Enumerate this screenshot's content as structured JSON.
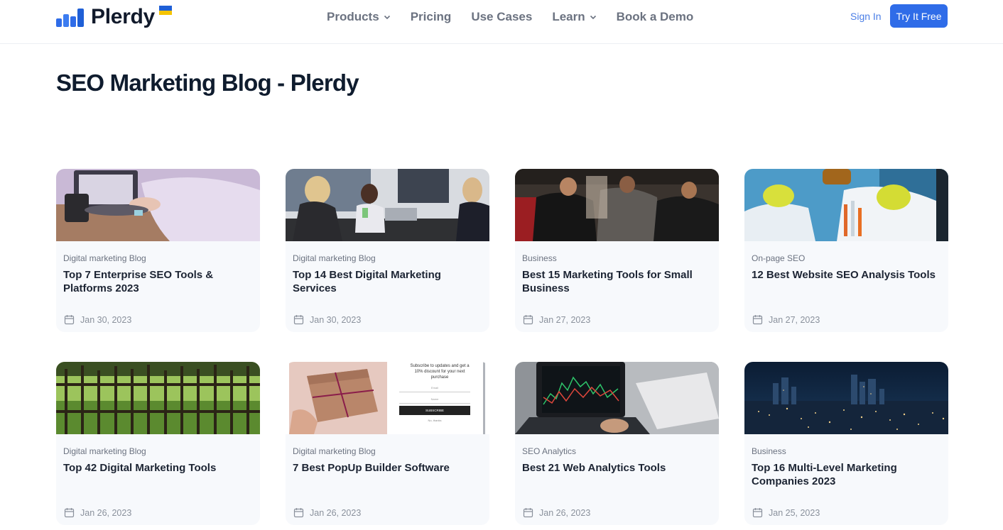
{
  "header": {
    "logo_text": "Plerdy",
    "nav": [
      {
        "label": "Products",
        "has_dropdown": true
      },
      {
        "label": "Pricing",
        "has_dropdown": false
      },
      {
        "label": "Use Cases",
        "has_dropdown": false
      },
      {
        "label": "Learn",
        "has_dropdown": true
      },
      {
        "label": "Book a Demo",
        "has_dropdown": false
      }
    ],
    "sign_in": "Sign In",
    "cta": "Try It Free"
  },
  "page_title": "SEO Marketing Blog - Plerdy",
  "colors": {
    "accent": "#2f6ce8",
    "flag_blue": "#1f5fd6",
    "flag_yellow": "#f5c400",
    "card_bg": "#f7f9fc"
  },
  "posts": [
    {
      "category": "Digital marketing Blog",
      "title": "Top 7 Enterprise SEO Tools & Platforms 2023",
      "date": "Jan 30, 2023",
      "image": "laptop-typing"
    },
    {
      "category": "Digital marketing Blog",
      "title": "Top 14 Best Digital Marketing Services",
      "date": "Jan 30, 2023",
      "image": "office-team"
    },
    {
      "category": "Business",
      "title": "Best 15 Marketing Tools for Small Business",
      "date": "Jan 27, 2023",
      "image": "barbershop"
    },
    {
      "category": "On-page SEO",
      "title": "12 Best Website SEO Analysis Tools",
      "date": "Jan 27, 2023",
      "image": "laboratory"
    },
    {
      "category": "Digital marketing Blog",
      "title": "Top 42 Digital Marketing Tools",
      "date": "Jan 26, 2023",
      "image": "garden-fence"
    },
    {
      "category": "Digital marketing Blog",
      "title": "7 Best PopUp Builder Software",
      "date": "Jan 26, 2023",
      "image": "gift-popup"
    },
    {
      "category": "SEO Analytics",
      "title": "Best 21 Web Analytics Tools",
      "date": "Jan 26, 2023",
      "image": "trading-laptop"
    },
    {
      "category": "Business",
      "title": "Top 16 Multi-Level Marketing Companies 2023",
      "date": "Jan 25, 2023",
      "image": "city-night"
    }
  ],
  "popup_thumb": {
    "text_line1": "Subscribe to updates and get a",
    "text_line2": "10% discount for your next",
    "text_line3": "purchase",
    "email_label": "Email",
    "name_label": "Name",
    "button": "SUBSCRIBE",
    "footer": "No, thanks"
  },
  "icons": {
    "calendar": "calendar-icon",
    "chevron": "chevron-down-icon",
    "logo": "plerdy-logo-icon"
  }
}
